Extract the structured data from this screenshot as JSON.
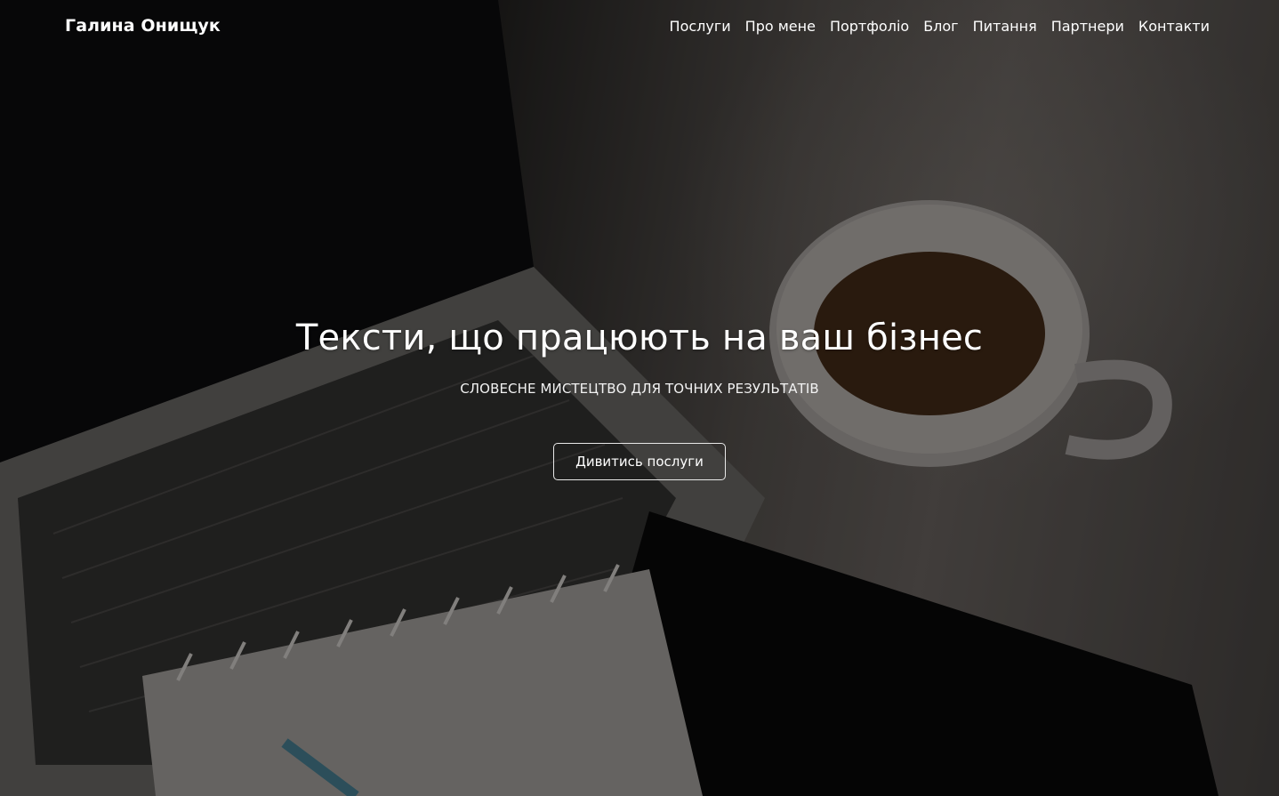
{
  "navbar": {
    "brand": "Галина Онищук",
    "links": [
      {
        "label": "Послуги"
      },
      {
        "label": "Про мене"
      },
      {
        "label": "Портфоліо"
      },
      {
        "label": "Блог"
      },
      {
        "label": "Питання"
      },
      {
        "label": "Партнери"
      },
      {
        "label": "Контакти"
      }
    ]
  },
  "hero": {
    "title": "Тексти, що працюють на ваш бізнес",
    "subtitle": "СЛОВЕСНЕ МИСТЕЦТВО ДЛЯ ТОЧНИХ РЕЗУЛЬТАТІВ",
    "cta_label": "Дивитись послуги",
    "background": "laptop-coffee-notebook-photo"
  },
  "colors": {
    "text": "#ffffff",
    "overlay": "#000000"
  }
}
